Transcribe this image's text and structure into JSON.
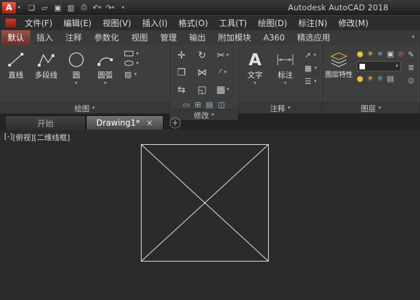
{
  "titlebar": {
    "title": "Autodesk AutoCAD 2018",
    "logo_letter": "A"
  },
  "menubar": {
    "items": [
      "文件(F)",
      "编辑(E)",
      "视图(V)",
      "插入(I)",
      "格式(O)",
      "工具(T)",
      "绘图(D)",
      "标注(N)",
      "修改(M)"
    ]
  },
  "ribbon": {
    "tabs": [
      "默认",
      "插入",
      "注释",
      "参数化",
      "视图",
      "管理",
      "输出",
      "附加模块",
      "A360",
      "精选应用"
    ],
    "active_tab": "默认",
    "panels": {
      "draw": {
        "label": "绘图",
        "tools": {
          "line": "直线",
          "polyline": "多段线",
          "circle": "圆",
          "arc": "圆弧"
        }
      },
      "modify": {
        "label": "修改"
      },
      "annotate": {
        "label": "注释",
        "tools": {
          "text": "文字",
          "dimension": "标注"
        }
      },
      "layer": {
        "label": "图层",
        "tools": {
          "layer_properties": "图层特性"
        }
      }
    }
  },
  "file_tabs": {
    "start": "开始",
    "drawing": "Drawing1*",
    "close_glyph": "×",
    "new_tab_glyph": "+"
  },
  "viewport": {
    "controls": [
      "[-]",
      "[俯视]",
      "[二维线框]"
    ]
  },
  "canvas": {
    "entities": "square with two diagonals forming an X, light lines on dark background"
  },
  "icons": {
    "chevron_down": "▾",
    "text_tool_glyph": "A",
    "new": "❏",
    "open": "▱",
    "save": "▣",
    "save_as": "▥",
    "plot": "⎙",
    "undo": "↶",
    "redo": "↷",
    "move": "✛",
    "rotate": "↻",
    "trim": "✂",
    "copy": "❐",
    "mirror": "⋈",
    "fillet": "◜",
    "stretch": "⇆",
    "scale": "◱",
    "array": "▦",
    "erase": "▭",
    "explode": "⊞",
    "offset": "▤",
    "join": "◫",
    "hatch": "▨",
    "leader": "↗",
    "table": "▦",
    "markup": "☰",
    "bulb": "●",
    "sun": "☀",
    "freeze": "✳",
    "lock": "▣",
    "plot_state": "⊘",
    "edit": "✎",
    "list": "≣",
    "settings": "⊙"
  },
  "colors": {
    "accent_red": "#b4352b",
    "active_tab_red": "#7a3a33",
    "bulb_yellow": "#e8c23c",
    "canvas_bg": "#2b2b2b",
    "line_color": "#e6e6e6"
  }
}
